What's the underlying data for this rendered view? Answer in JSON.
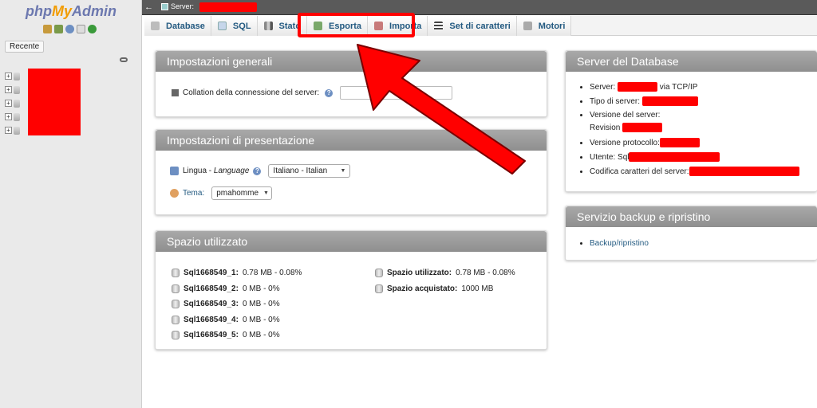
{
  "sidebar": {
    "logo": {
      "php": "php",
      "my": "My",
      "admin": "Admin"
    },
    "quick_icons": [
      "home-icon",
      "database-icon",
      "help-icon",
      "docs-icon",
      "reload-icon"
    ],
    "recent_label": "Recente",
    "tree_rows": 5
  },
  "topbar": {
    "server_label": "Server:"
  },
  "tabs": [
    {
      "label": "Database",
      "icon": "database-icon"
    },
    {
      "label": "SQL",
      "icon": "sql-icon"
    },
    {
      "label": "Stato",
      "icon": "status-icon"
    },
    {
      "label": "Esporta",
      "icon": "export-icon"
    },
    {
      "label": "Importa",
      "icon": "import-icon"
    },
    {
      "label": "Set di caratteri",
      "icon": "charset-icon"
    },
    {
      "label": "Motori",
      "icon": "engines-icon"
    }
  ],
  "general_settings": {
    "title": "Impostazioni generali",
    "collation_label": "Collation della connessione del server:",
    "collation_value": ""
  },
  "appearance_settings": {
    "title": "Impostazioni di presentazione",
    "language_label": "Lingua - ",
    "language_label_italic": "Language",
    "language_value": "Italiano - Italian",
    "theme_label": "Tema:",
    "theme_value": "pmahomme"
  },
  "space": {
    "title": "Spazio utilizzato",
    "databases": [
      {
        "name": "Sql1668549_1:",
        "value": "0.78 MB - 0.08%"
      },
      {
        "name": "Sql1668549_2:",
        "value": "0 MB - 0%"
      },
      {
        "name": "Sql1668549_3:",
        "value": "0 MB - 0%"
      },
      {
        "name": "Sql1668549_4:",
        "value": "0 MB - 0%"
      },
      {
        "name": "Sql1668549_5:",
        "value": "0 MB - 0%"
      }
    ],
    "used_label": "Spazio utilizzato:",
    "used_value": "0.78 MB - 0.08%",
    "purchased_label": "Spazio acquistato:",
    "purchased_value": "1000 MB"
  },
  "db_server": {
    "title": "Server del Database",
    "server_label": "Server:",
    "server_suffix": "via TCP/IP",
    "server_type_label": "Tipo di server:",
    "server_version_label": "Versione del server:",
    "revision_label": "Revision",
    "protocol_label": "Versione protocollo:",
    "user_label": "Utente: Sql",
    "charset_label": "Codifica caratteri del server:"
  },
  "backup": {
    "title": "Servizio backup e ripristino",
    "link": "Backup/ripristino"
  },
  "colors": {
    "redaction": "#ff0000",
    "link": "#235a81",
    "panel_header": "#999999"
  }
}
